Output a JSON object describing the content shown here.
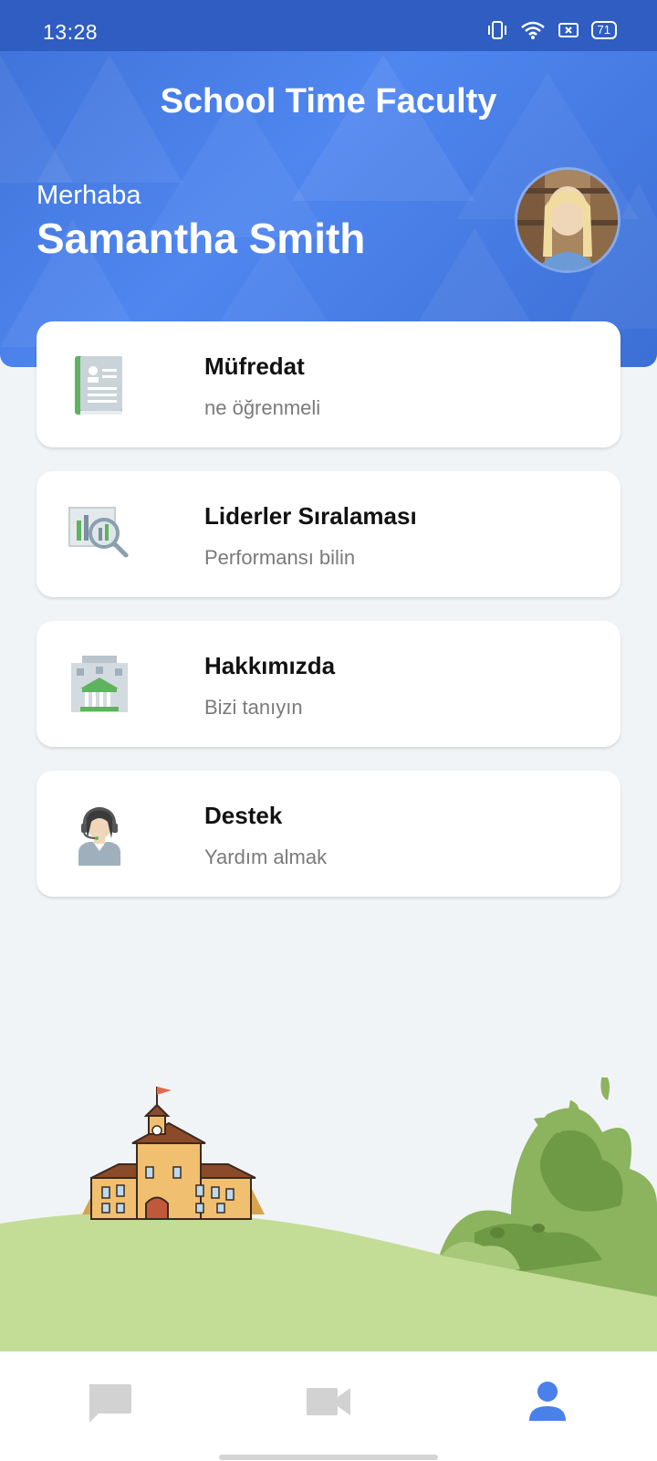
{
  "status_bar": {
    "time": "13:28",
    "battery": "71",
    "icons": [
      "vibrate-icon",
      "wifi-icon",
      "sim-icon",
      "battery-icon"
    ]
  },
  "header": {
    "title": "School Time Faculty",
    "greeting": "Merhaba",
    "user_name": "Samantha Smith"
  },
  "menu": [
    {
      "title": "Müfredat",
      "subtitle": "ne öğrenmeli",
      "icon": "book-icon"
    },
    {
      "title": "Liderler Sıralaması",
      "subtitle": "Performansı bilin",
      "icon": "chart-search-icon"
    },
    {
      "title": "Hakkımızda",
      "subtitle": "Bizi tanıyın",
      "icon": "building-icon"
    },
    {
      "title": "Destek",
      "subtitle": "Yardım almak",
      "icon": "support-agent-icon"
    }
  ],
  "bottom_nav": [
    {
      "icon": "chat-icon",
      "active": false
    },
    {
      "icon": "video-icon",
      "active": false
    },
    {
      "icon": "profile-icon",
      "active": true
    }
  ],
  "colors": {
    "primary": "#4a80ea",
    "nav_inactive": "#d2d2d2",
    "nav_active": "#4a80ea",
    "hill": "#c3dd96",
    "bush": "#8cb35e"
  }
}
